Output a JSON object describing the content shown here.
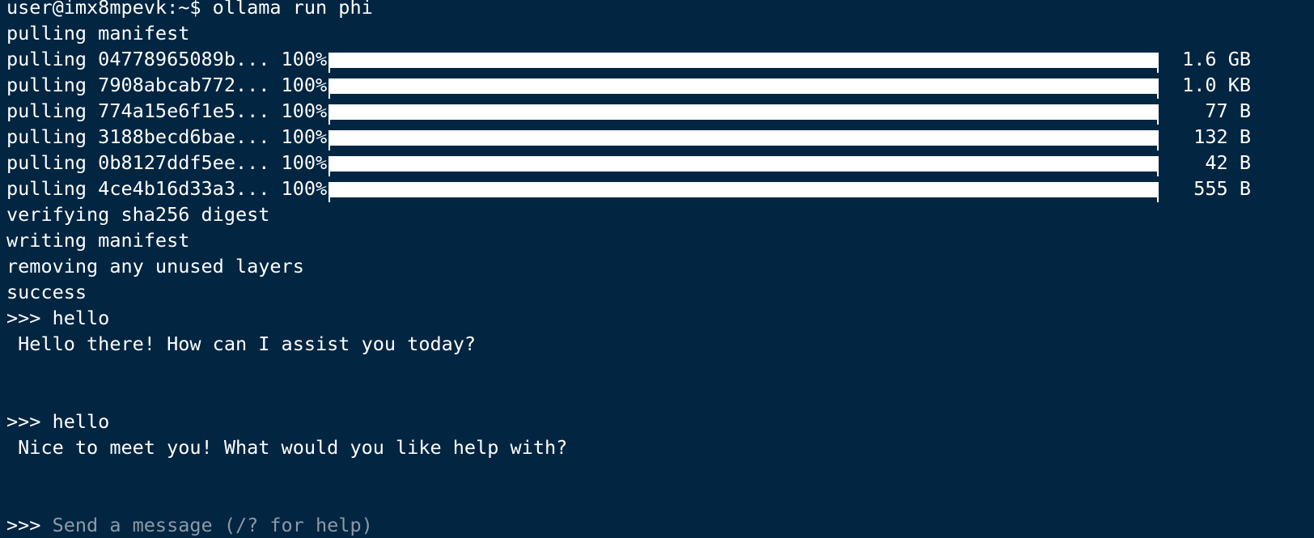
{
  "terminal": {
    "command_line": "user@imx8mpevk:~$ ollama run phi",
    "pulling_manifest": "pulling manifest",
    "pull_rows": [
      {
        "label": "pulling 04778965089b... 100%",
        "progress": 1.0,
        "size": "1.6 GB"
      },
      {
        "label": "pulling 7908abcab772... 100%",
        "progress": 1.0,
        "size": "1.0 KB"
      },
      {
        "label": "pulling 774a15e6f1e5... 100%",
        "progress": 1.0,
        "size": "77 B"
      },
      {
        "label": "pulling 3188becd6bae... 100%",
        "progress": 1.0,
        "size": "132 B"
      },
      {
        "label": "pulling 0b8127ddf5ee... 100%",
        "progress": 1.0,
        "size": "42 B"
      },
      {
        "label": "pulling 4ce4b16d33a3... 100%",
        "progress": 1.0,
        "size": "555 B"
      }
    ],
    "verifying": "verifying sha256 digest",
    "writing": "writing manifest",
    "removing": "removing any unused layers",
    "success": "success",
    "exchanges": [
      {
        "prompt": ">>> hello",
        "response": " Hello there! How can I assist you today?"
      },
      {
        "prompt": ">>> hello",
        "response": " Nice to meet you! What would you like help with?"
      }
    ],
    "input": {
      "prompt_symbol": ">>> ",
      "placeholder": "Send a message (/? for help)"
    }
  },
  "colors": {
    "background": "#022541",
    "text": "#ffffff",
    "placeholder": "#8d99a6"
  }
}
